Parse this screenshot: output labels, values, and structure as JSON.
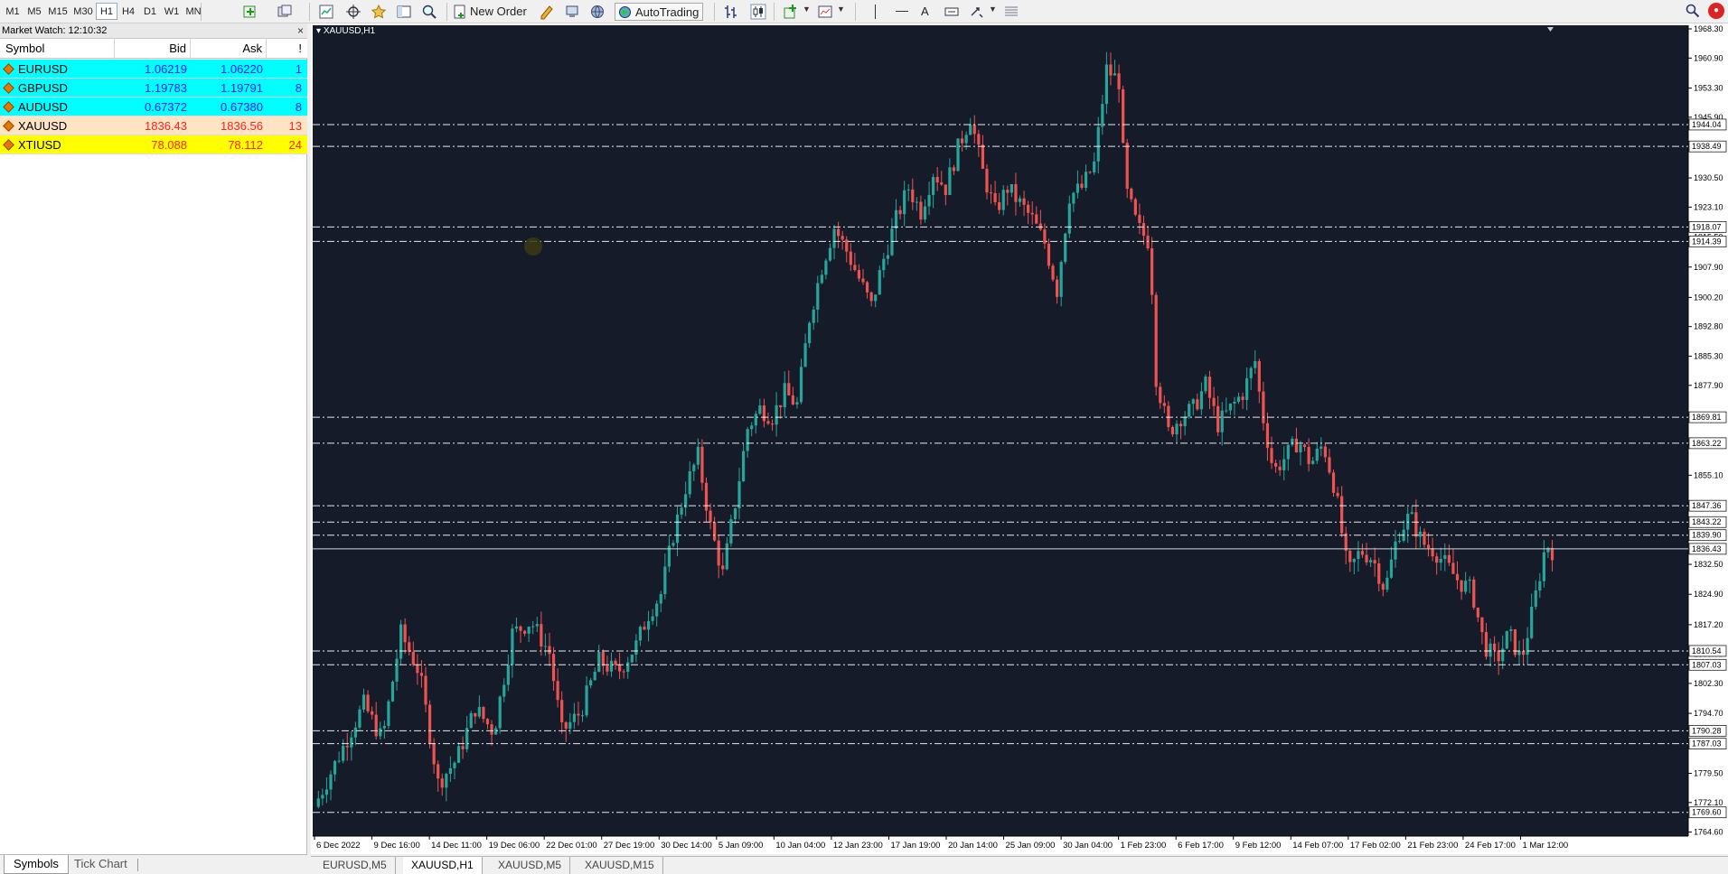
{
  "toolbar": {
    "timeframes": [
      "M1",
      "M5",
      "M15",
      "M30",
      "H1",
      "H4",
      "D1",
      "W1",
      "MN"
    ],
    "active_timeframe": "H1",
    "new_order_label": "New Order",
    "autotrading_label": "AutoTrading",
    "text_tool_label": "A"
  },
  "market_watch": {
    "title": "Market Watch: 12:10:32",
    "close_glyph": "×",
    "columns": {
      "symbol": "Symbol",
      "bid": "Bid",
      "ask": "Ask",
      "spread": "!"
    },
    "rows": [
      {
        "symbol": "EURUSD",
        "bid": "1.06219",
        "ask": "1.06220",
        "spread": "1",
        "bg": "#00ffff",
        "fg": "#1a1aff"
      },
      {
        "symbol": "GBPUSD",
        "bid": "1.19783",
        "ask": "1.19791",
        "spread": "8",
        "bg": "#00ffff",
        "fg": "#1a1aff"
      },
      {
        "symbol": "AUDUSD",
        "bid": "0.67372",
        "ask": "0.67380",
        "spread": "8",
        "bg": "#00ffff",
        "fg": "#1a1aff"
      },
      {
        "symbol": "XAUUSD",
        "bid": "1836.43",
        "ask": "1836.56",
        "spread": "13",
        "bg": "#ffe4c4",
        "fg": "#ff2020"
      },
      {
        "symbol": "XTIUSD",
        "bid": "78.088",
        "ask": "78.112",
        "spread": "24",
        "bg": "#ffff00",
        "fg": "#ff2020"
      }
    ],
    "tabs": [
      "Symbols",
      "Tick Chart"
    ],
    "active_tab": "Symbols"
  },
  "chart": {
    "label": "XAUUSD,H1",
    "colors": {
      "background": "#161b29",
      "bull": "#26a69a",
      "bear": "#ef5350",
      "grid": "#ffffff"
    },
    "price_min": 1764.5,
    "price_max": 1968.3,
    "price_ticks": [
      "1968.30",
      "1960.90",
      "1953.30",
      "1945.90",
      "1938.49",
      "1930.50",
      "1923.10",
      "1915.50",
      "1907.90",
      "1900.20",
      "1892.80",
      "1885.30",
      "1877.90",
      "1870.40",
      "1862.80",
      "1855.10",
      "1847.70",
      "1840.00",
      "1832.50",
      "1824.90",
      "1817.20",
      "1809.70",
      "1802.30",
      "1794.70",
      "1787.10",
      "1779.50",
      "1772.10",
      "1764.60"
    ],
    "h_lines": [
      {
        "price": 1944.04,
        "label": "1944.04"
      },
      {
        "price": 1938.49,
        "label": "1938.49"
      },
      {
        "price": 1918.07,
        "label": "1918.07"
      },
      {
        "price": 1914.39,
        "label": "1914.39"
      },
      {
        "price": 1869.81,
        "label": "1869.81"
      },
      {
        "price": 1863.22,
        "label": "1863.22"
      },
      {
        "price": 1847.36,
        "label": "1847.36"
      },
      {
        "price": 1843.22,
        "label": "1843.22"
      },
      {
        "price": 1839.9,
        "label": "1839.90"
      },
      {
        "price": 1810.54,
        "label": "1810.54"
      },
      {
        "price": 1807.03,
        "label": "1807.03"
      },
      {
        "price": 1790.28,
        "label": "1790.28"
      },
      {
        "price": 1787.03,
        "label": "1787.03"
      },
      {
        "price": 1769.6,
        "label": "1769.60"
      }
    ],
    "bid_line": {
      "price": 1836.43,
      "label": "1836.43"
    },
    "time_labels": [
      "6 Dec 2022",
      "9 Dec 16:00",
      "14 Dec 11:00",
      "19 Dec 06:00",
      "22 Dec 01:00",
      "27 Dec 19:00",
      "30 Dec 14:00",
      "5 Jan 09:00",
      "10 Jan 04:00",
      "12 Jan 23:00",
      "17 Jan 19:00",
      "20 Jan 14:00",
      "25 Jan 09:00",
      "30 Jan 04:00",
      "1 Feb 23:00",
      "6 Feb 17:00",
      "9 Feb 12:00",
      "14 Feb 07:00",
      "17 Feb 02:00",
      "21 Feb 23:00",
      "24 Feb 17:00",
      "1 Mar 12:00"
    ],
    "price_path": [
      [
        0,
        1771
      ],
      [
        0.02,
        1784
      ],
      [
        0.04,
        1797
      ],
      [
        0.055,
        1788
      ],
      [
        0.07,
        1815
      ],
      [
        0.085,
        1805
      ],
      [
        0.1,
        1777
      ],
      [
        0.115,
        1783
      ],
      [
        0.13,
        1796
      ],
      [
        0.145,
        1790
      ],
      [
        0.16,
        1815
      ],
      [
        0.175,
        1818
      ],
      [
        0.19,
        1810
      ],
      [
        0.2,
        1790
      ],
      [
        0.215,
        1795
      ],
      [
        0.23,
        1808
      ],
      [
        0.245,
        1805
      ],
      [
        0.26,
        1812
      ],
      [
        0.27,
        1820
      ],
      [
        0.28,
        1825
      ],
      [
        0.29,
        1840
      ],
      [
        0.3,
        1852
      ],
      [
        0.31,
        1860
      ],
      [
        0.32,
        1842
      ],
      [
        0.33,
        1830
      ],
      [
        0.34,
        1848
      ],
      [
        0.35,
        1867
      ],
      [
        0.36,
        1872
      ],
      [
        0.37,
        1870
      ],
      [
        0.38,
        1876
      ],
      [
        0.39,
        1873
      ],
      [
        0.4,
        1895
      ],
      [
        0.41,
        1908
      ],
      [
        0.42,
        1918
      ],
      [
        0.43,
        1912
      ],
      [
        0.44,
        1905
      ],
      [
        0.45,
        1898
      ],
      [
        0.46,
        1910
      ],
      [
        0.47,
        1920
      ],
      [
        0.48,
        1928
      ],
      [
        0.49,
        1922
      ],
      [
        0.5,
        1932
      ],
      [
        0.51,
        1928
      ],
      [
        0.52,
        1938
      ],
      [
        0.53,
        1946
      ],
      [
        0.54,
        1932
      ],
      [
        0.55,
        1922
      ],
      [
        0.56,
        1928
      ],
      [
        0.57,
        1924
      ],
      [
        0.58,
        1920
      ],
      [
        0.59,
        1914
      ],
      [
        0.6,
        1902
      ],
      [
        0.61,
        1926
      ],
      [
        0.62,
        1928
      ],
      [
        0.63,
        1934
      ],
      [
        0.64,
        1958
      ],
      [
        0.65,
        1955
      ],
      [
        0.655,
        1928
      ],
      [
        0.665,
        1918
      ],
      [
        0.675,
        1914
      ],
      [
        0.68,
        1880
      ],
      [
        0.69,
        1866
      ],
      [
        0.7,
        1870
      ],
      [
        0.71,
        1872
      ],
      [
        0.72,
        1878
      ],
      [
        0.73,
        1868
      ],
      [
        0.74,
        1872
      ],
      [
        0.75,
        1876
      ],
      [
        0.76,
        1884
      ],
      [
        0.765,
        1872
      ],
      [
        0.775,
        1856
      ],
      [
        0.785,
        1860
      ],
      [
        0.795,
        1864
      ],
      [
        0.805,
        1858
      ],
      [
        0.815,
        1863
      ],
      [
        0.825,
        1851
      ],
      [
        0.835,
        1830
      ],
      [
        0.845,
        1836
      ],
      [
        0.855,
        1834
      ],
      [
        0.865,
        1826
      ],
      [
        0.875,
        1840
      ],
      [
        0.885,
        1845
      ],
      [
        0.895,
        1838
      ],
      [
        0.905,
        1836
      ],
      [
        0.915,
        1832
      ],
      [
        0.925,
        1828
      ],
      [
        0.935,
        1826
      ],
      [
        0.945,
        1812
      ],
      [
        0.955,
        1808
      ],
      [
        0.965,
        1815
      ],
      [
        0.975,
        1808
      ],
      [
        0.985,
        1822
      ],
      [
        0.995,
        1838
      ],
      [
        1,
        1836
      ]
    ],
    "path_x_end": 0.9
  },
  "chart_tabs": [
    "EURUSD,M5",
    "XAUUSD,H1",
    "XAUUSD,M5",
    "XAUUSD,M15"
  ],
  "active_chart_tab": "XAUUSD,H1"
}
